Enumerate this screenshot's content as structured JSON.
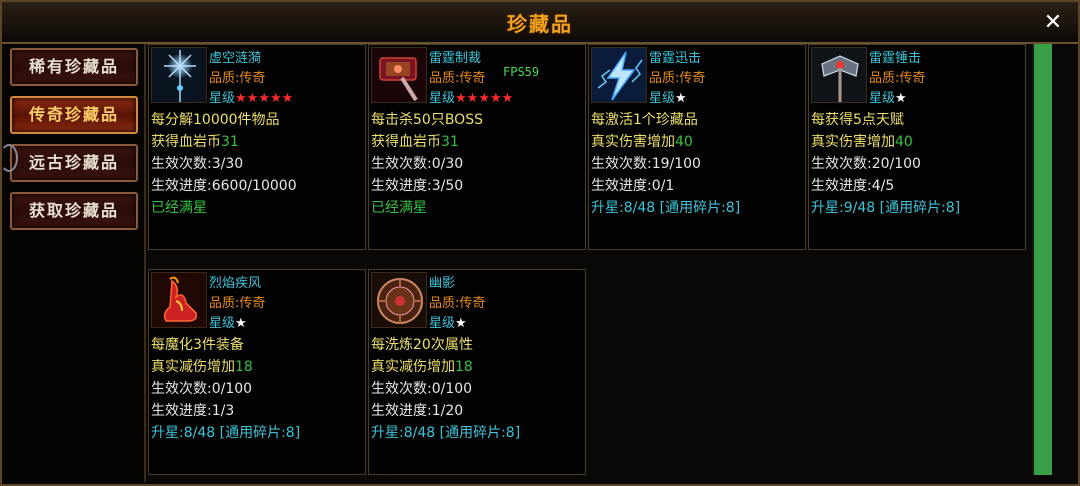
{
  "title": "珍藏品",
  "tabs": [
    "稀有珍藏品",
    "传奇珍藏品",
    "远古珍藏品",
    "获取珍藏品"
  ],
  "active_tab": 1,
  "fps_label": "FPS59",
  "cards": [
    {
      "name": "虚空涟漪",
      "quality": "品质:传奇",
      "star_label": "星级",
      "stars": "★★★★★",
      "star_color": "red",
      "line1": "每分解10000件物品",
      "line2_text": "获得血岩币",
      "line2_num": "31",
      "count": "生效次数:3/30",
      "progress": "生效进度:6600/10000",
      "status": "已经满星",
      "status_type": "done",
      "icon": "void-staff-icon"
    },
    {
      "name": "雷霆制裁",
      "quality": "品质:传奇",
      "star_label": "星级",
      "stars": "★★★★★",
      "star_color": "red",
      "line1": "每击杀50只BOSS",
      "line2_text": "获得血岩币",
      "line2_num": "31",
      "count": "生效次数:0/30",
      "progress": "生效进度:3/50",
      "status": "已经满星",
      "status_type": "done",
      "icon": "thunder-hammer-icon"
    },
    {
      "name": "雷霆迅击",
      "quality": "品质:传奇",
      "star_label": "星级",
      "stars": "★",
      "star_color": "white",
      "line1": "每激活1个珍藏品",
      "line2_text": "真实伤害增加",
      "line2_num": "40",
      "count": "生效次数:19/100",
      "progress": "生效进度:0/1",
      "status": "升星:8/48  [通用碎片:8]",
      "status_type": "upgrade",
      "icon": "lightning-icon"
    },
    {
      "name": "雷霆锤击",
      "quality": "品质:传奇",
      "star_label": "星级",
      "stars": "★",
      "star_color": "white",
      "line1": "每获得5点天赋",
      "line2_text": "真实伤害增加",
      "line2_num": "40",
      "count": "生效次数:20/100",
      "progress": "生效进度:4/5",
      "status": "升星:9/48  [通用碎片:8]",
      "status_type": "upgrade",
      "icon": "axe-icon"
    },
    {
      "name": "烈焰疾风",
      "quality": "品质:传奇",
      "star_label": "星级",
      "stars": "★",
      "star_color": "white",
      "line1": "每魔化3件装备",
      "line2_text": "真实减伤增加",
      "line2_num": "18",
      "count": "生效次数:0/100",
      "progress": "生效进度:1/3",
      "status": "升星:8/48  [通用碎片:8]",
      "status_type": "upgrade",
      "icon": "flame-boots-icon"
    },
    {
      "name": "幽影",
      "quality": "品质:传奇",
      "star_label": "星级",
      "stars": "★",
      "star_color": "white",
      "line1": "每洗炼20次属性",
      "line2_text": "真实减伤增加",
      "line2_num": "18",
      "count": "生效次数:0/100",
      "progress": "生效进度:1/20",
      "status": "升星:8/48  [通用碎片:8]",
      "status_type": "upgrade",
      "icon": "shadow-shield-icon"
    }
  ]
}
